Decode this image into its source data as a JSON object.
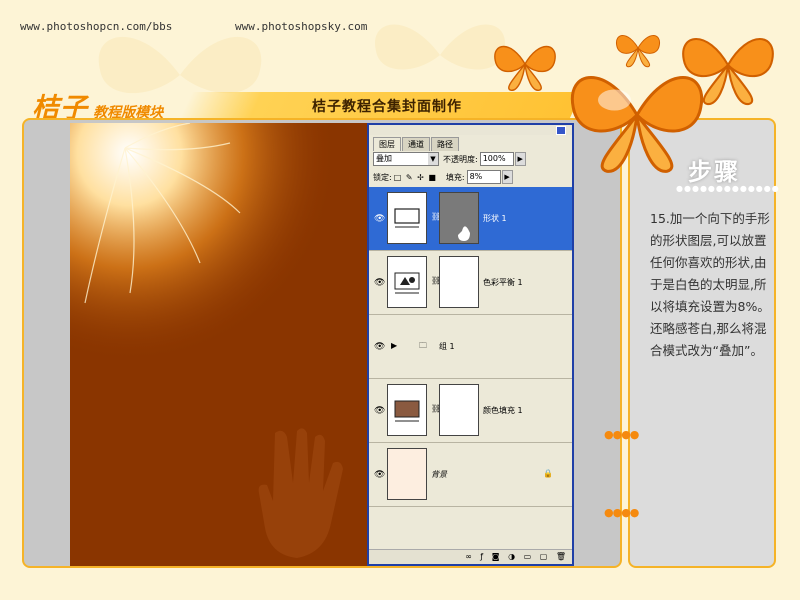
{
  "header": {
    "url_left": "www.photoshopcn.com/bbs",
    "url_right": "www.photoshopsky.com",
    "brand_big": "桔子",
    "brand_small": "教程版模块",
    "page_title": "桔子教程合集封面制作"
  },
  "ps_panel": {
    "tabs": [
      "图层",
      "通道",
      "路径"
    ],
    "blend_mode": "叠加",
    "opacity_label": "不透明度:",
    "opacity_value": "100%",
    "lock_label": "锁定:",
    "fill_label": "填充:",
    "fill_value": "8%",
    "layers": [
      {
        "name": "形状 1",
        "selected": true
      },
      {
        "name": "色彩平衡 1",
        "selected": false
      },
      {
        "name": "组 1",
        "selected": false
      },
      {
        "name": "颜色填充 1",
        "selected": false
      },
      {
        "name": "背景",
        "selected": false
      }
    ]
  },
  "step": {
    "title": "步骤",
    "dots": "●●●●●●●●●●●●●",
    "text": "15.加一个向下的手形的形状图层,可以放置任何你喜欢的形状,由于是白色的太明显,所以将填充设置为8%。还略感苍白,那么将混合模式改为“叠加”。"
  },
  "colors": {
    "accent": "#f5b327",
    "canvas": "#8a3500",
    "selection": "#2f6ad4"
  }
}
